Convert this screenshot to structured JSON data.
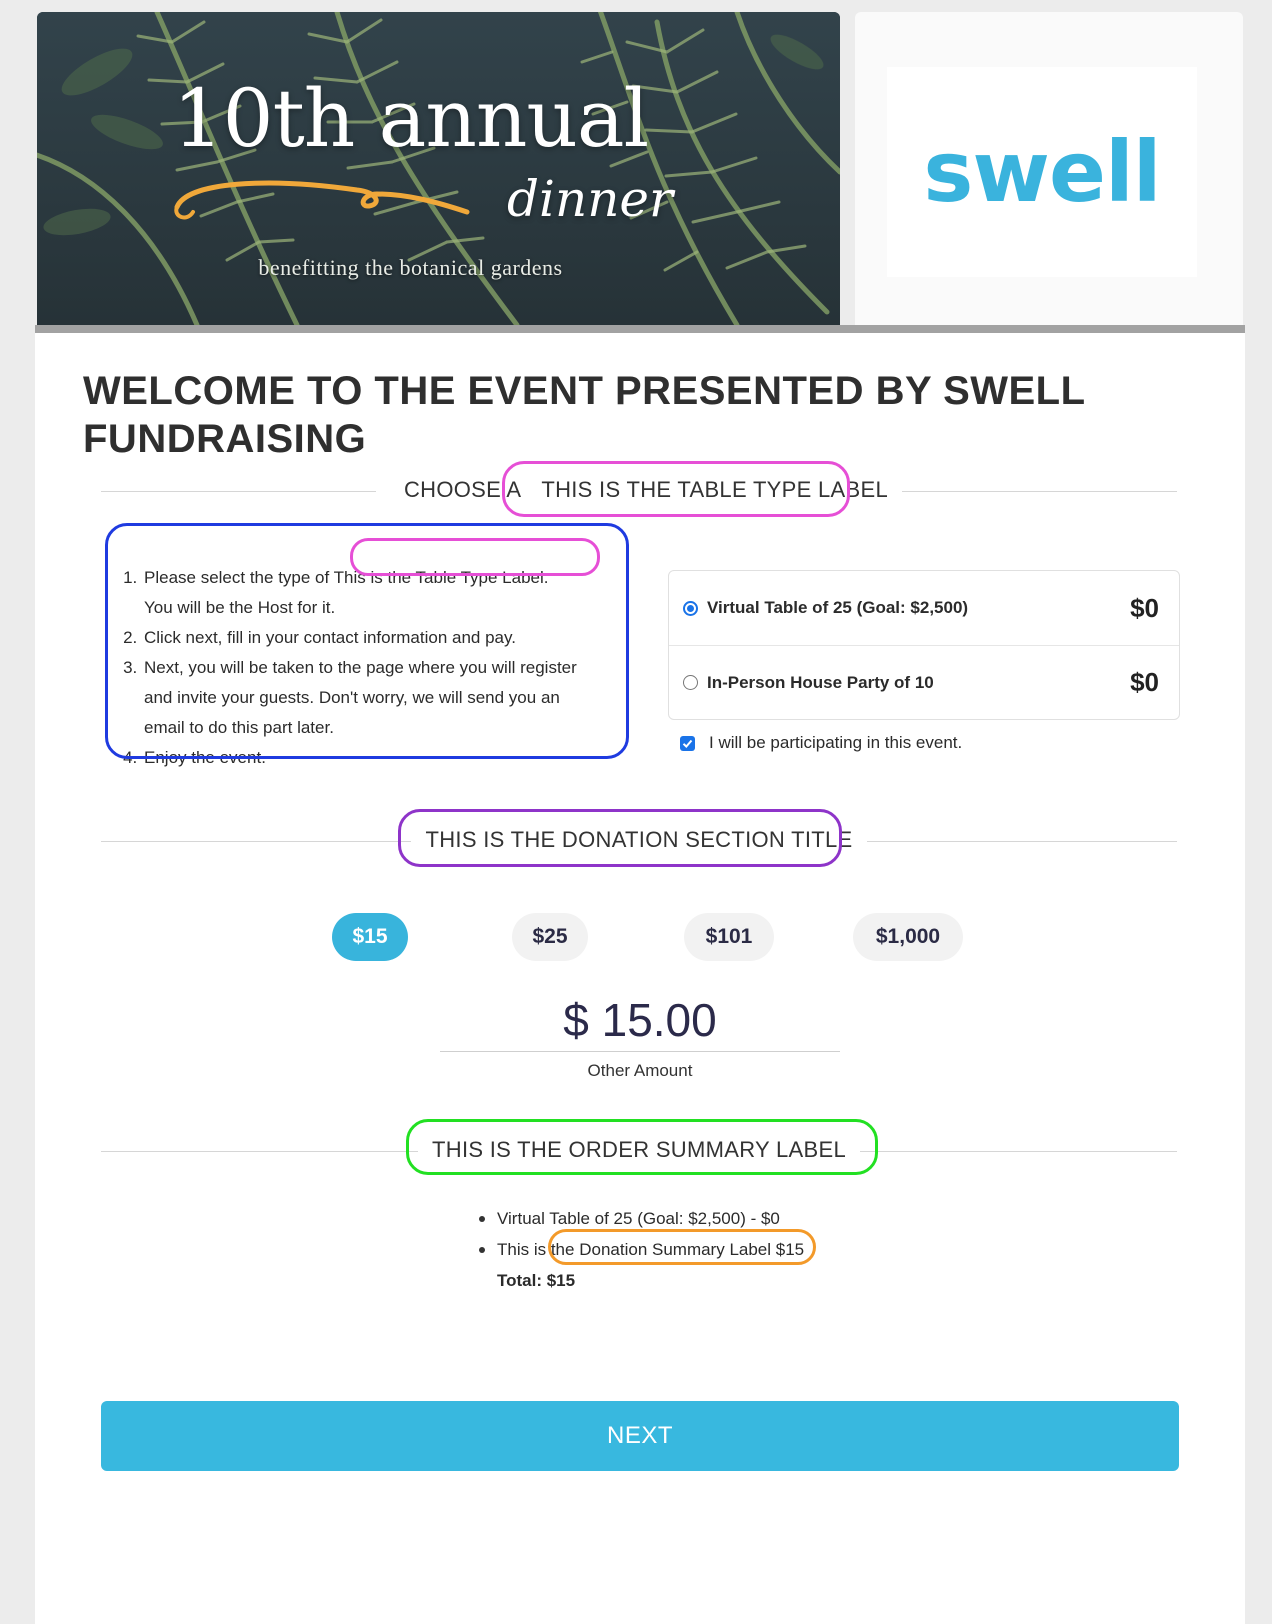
{
  "banner": {
    "title": "10th annual",
    "script": "dinner",
    "subtitle": "benefitting the botanical gardens"
  },
  "logo": {
    "text": "swell"
  },
  "welcome": "WELCOME TO THE EVENT PRESENTED BY SWELL FUNDRAISING",
  "table_section": {
    "title_prefix": "CHOOSE A",
    "title_label": "THIS IS THE TABLE TYPE LABEL",
    "steps": {
      "step1_prefix": "Please select the type of",
      "step1_label": "This is the Table Type Label.",
      "step1_suffix": "You will be the Host for it.",
      "step2": "Click next, fill in your contact information and pay.",
      "step3": "Next, you will be taken to the page where you will register and invite your guests. Don't worry, we will send you an email to do this part later.",
      "step4": "Enjoy the event."
    },
    "options": [
      {
        "label": "Virtual Table of 25 (Goal: $2,500)",
        "price": "$0",
        "selected": true
      },
      {
        "label": "In-Person House Party of 10",
        "price": "$0",
        "selected": false
      }
    ],
    "participating_label": "I will be participating in this event.",
    "participating_checked": true
  },
  "donation": {
    "title": "THIS IS THE DONATION SECTION TITLE",
    "amounts": [
      "$15",
      "$25",
      "$101",
      "$1,000"
    ],
    "selected_amount": "$15",
    "amount_display": "$ 15.00",
    "other_amount_label": "Other Amount"
  },
  "order_summary": {
    "title": "THIS IS THE ORDER SUMMARY LABEL",
    "line1": "Virtual Table of 25 (Goal: $2,500) - $0",
    "line2_prefix": "This is the",
    "line2_label": "Donation Summary Label $15",
    "total": "Total: $15"
  },
  "next_button": "NEXT",
  "colors": {
    "accent": "#38b4dc",
    "annotation_pink": "#e64fd6",
    "annotation_blue": "#1f3be0",
    "annotation_purple": "#8e34c9",
    "annotation_green": "#22e022",
    "annotation_orange": "#f39a2a"
  }
}
